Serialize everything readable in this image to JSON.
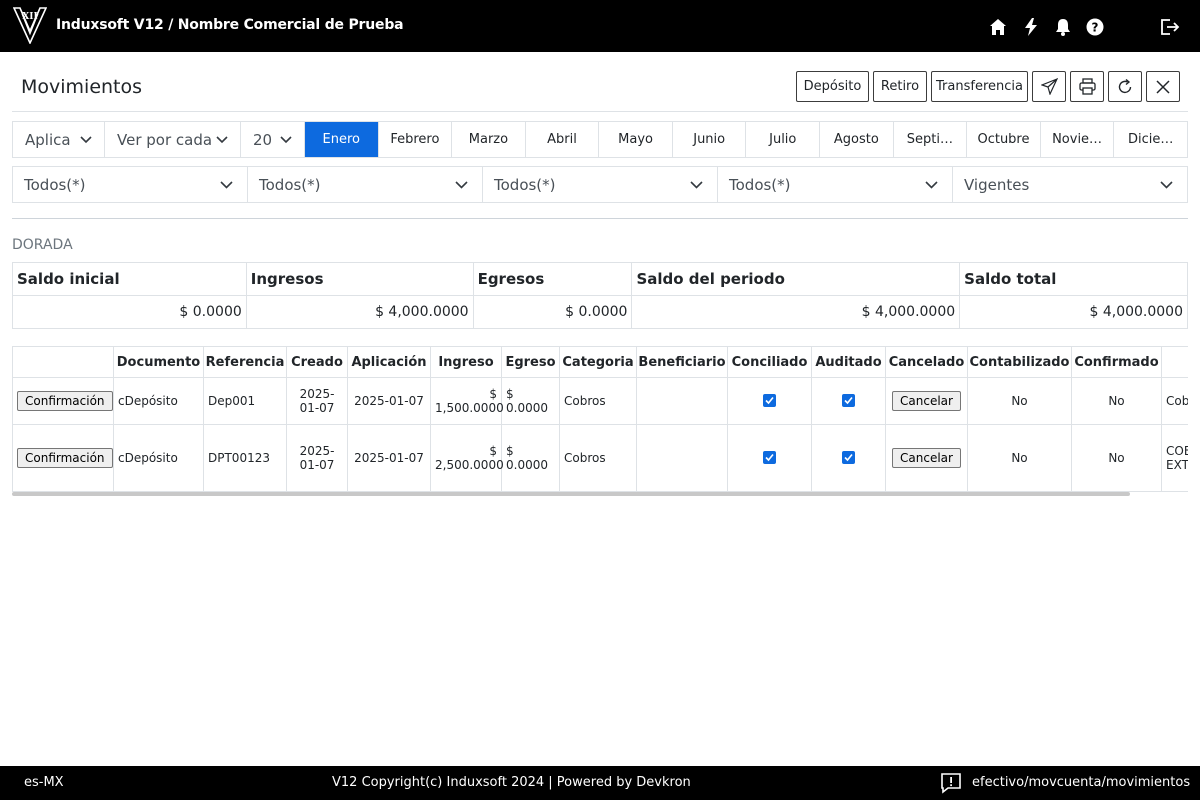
{
  "topbar": {
    "title": "Induxsoft V12 / Nombre Comercial de Prueba",
    "logo_text": "XII",
    "icons": [
      "home-icon",
      "bolt-icon",
      "bell-icon",
      "help-icon",
      "logout-icon"
    ]
  },
  "header": {
    "title": "Movimientos",
    "buttons": {
      "deposito": "Depósito",
      "retiro": "Retiro",
      "transferencia": "Transferencia"
    },
    "icon_buttons": [
      "send-icon",
      "print-icon",
      "refresh-icon",
      "close-icon"
    ]
  },
  "period": {
    "apply_select": "Aplica",
    "view_select": "Ver por cada",
    "year_select": "20",
    "months": [
      "Enero",
      "Febrero",
      "Marzo",
      "Abril",
      "Mayo",
      "Junio",
      "Julio",
      "Agosto",
      "Septi…",
      "Octubre",
      "Novie…",
      "Dicie…"
    ],
    "active_month": "Enero"
  },
  "filters": [
    "Todos(*)",
    "Todos(*)",
    "Todos(*)",
    "Todos(*)",
    "Vigentes"
  ],
  "account": {
    "name": "DORADA",
    "summary_headers": [
      "Saldo inicial",
      "Ingresos",
      "Egresos",
      "Saldo del periodo",
      "Saldo total"
    ],
    "summary_values": [
      "$ 0.0000",
      "$ 4,000.0000",
      "$ 0.0000",
      "$ 4,000.0000",
      "$ 4,000.0000"
    ]
  },
  "movements": {
    "headers": [
      "",
      "Documento",
      "Referencia",
      "Creado",
      "Aplicación",
      "Ingreso",
      "Egreso",
      "Categoria",
      "Beneficiario",
      "Conciliado",
      "Auditado",
      "Cancelado",
      "Contabilizado",
      "Confirmado",
      ""
    ],
    "rows": [
      {
        "action": "Confirmación",
        "documento": "cDepósito",
        "referencia": "Dep001",
        "creado": "2025-01-07",
        "aplicacion": "2025-01-07",
        "ingreso": "$ 1,500.0000",
        "egreso": "$ 0.0000",
        "categoria": "Cobros",
        "beneficiario": "",
        "conciliado": true,
        "auditado": true,
        "cancelar": "Cancelar",
        "contabilizado": "No",
        "confirmado": "No",
        "extra": "Cob prot"
      },
      {
        "action": "Confirmación",
        "documento": "cDepósito",
        "referencia": "DPT00123",
        "creado": "2025-01-07",
        "aplicacion": "2025-01-07",
        "ingreso": "$ 2,500.0000",
        "egreso": "$ 0.0000",
        "categoria": "Cobros",
        "beneficiario": "",
        "conciliado": true,
        "auditado": true,
        "cancelar": "Cancelar",
        "contabilizado": "No",
        "confirmado": "No",
        "extra": "COB PRO EXT"
      }
    ]
  },
  "footer": {
    "locale": "es-MX",
    "copyright": "V12 Copyright(c) Induxsoft 2024 | Powered by Devkron",
    "route": "efectivo/movcuenta/movimientos"
  },
  "colors": {
    "accent": "#0d6adf",
    "topbar": "#000000",
    "border": "#dee2e6"
  }
}
